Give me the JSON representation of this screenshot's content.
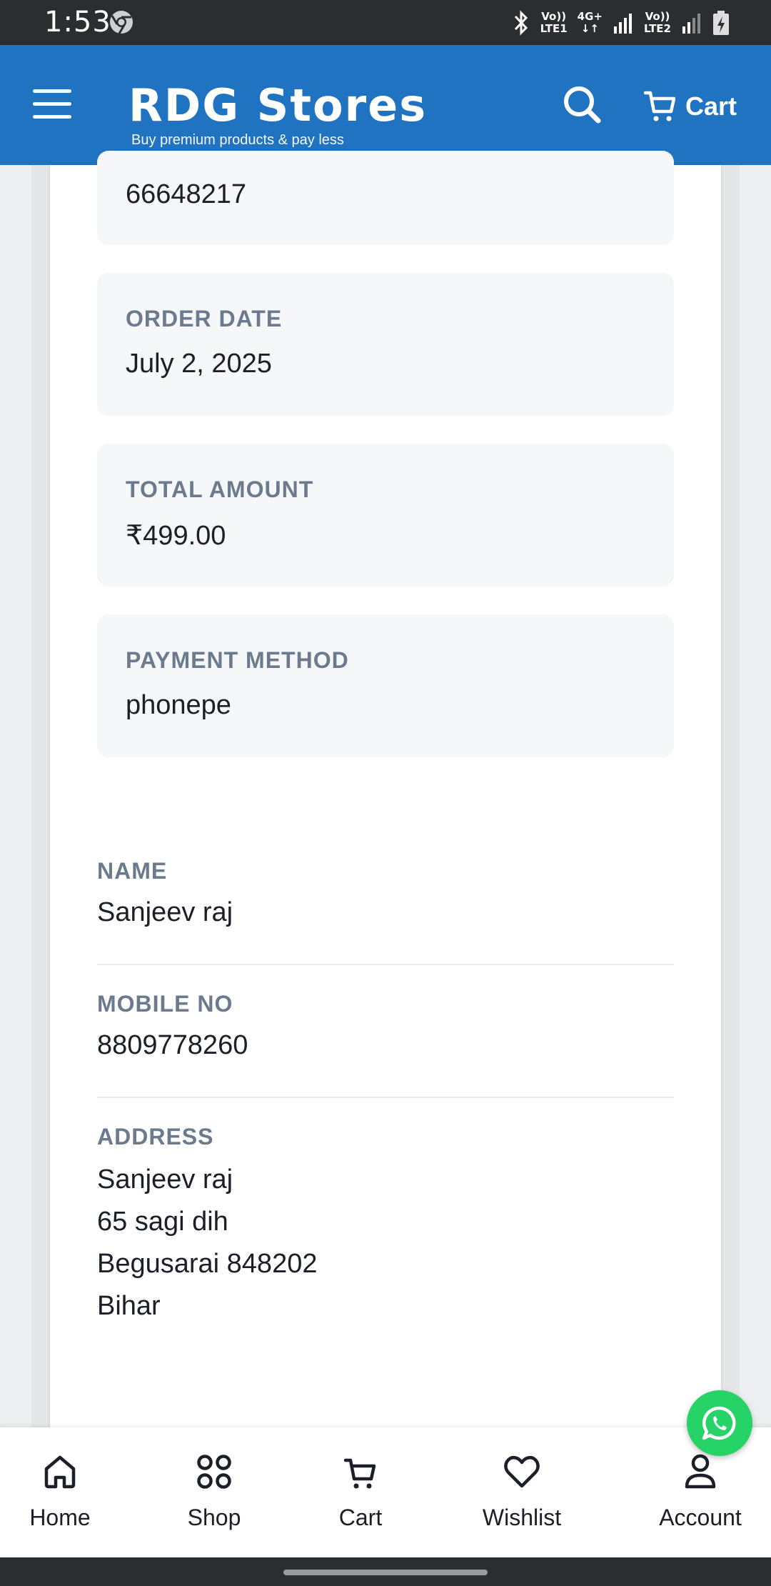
{
  "status_bar": {
    "time": "1:53",
    "network1_top": "Vo))",
    "network1_bottom": "LTE1",
    "data_type": "4G+",
    "network2_top": "Vo))",
    "network2_bottom": "LTE2"
  },
  "header": {
    "brand_title": "RDG Stores",
    "brand_tagline": "Buy premium products & pay less",
    "cart_label": "Cart",
    "background_color": "#1f73c1"
  },
  "order_details": {
    "order_number_value": "66648217",
    "order_date_label": "ORDER DATE",
    "order_date_value": "July 2, 2025",
    "total_amount_label": "TOTAL AMOUNT",
    "total_amount_value": "₹499.00",
    "payment_method_label": "PAYMENT METHOD",
    "payment_method_value": "phonepe"
  },
  "customer": {
    "name_label": "NAME",
    "name_value": "Sanjeev raj",
    "mobile_label": "MOBILE NO",
    "mobile_value": "8809778260",
    "address_label": "ADDRESS",
    "address_lines": [
      "Sanjeev raj",
      "65 sagi dih",
      "Begusarai 848202",
      "Bihar"
    ]
  },
  "bottom_nav": {
    "items": [
      {
        "label": "Home",
        "icon": "home-icon"
      },
      {
        "label": "Shop",
        "icon": "grid-dots-icon"
      },
      {
        "label": "Cart",
        "icon": "cart-icon"
      },
      {
        "label": "Wishlist",
        "icon": "heart-icon"
      },
      {
        "label": "Account",
        "icon": "user-icon"
      }
    ]
  },
  "colors": {
    "label_gray": "#6c7a8d",
    "whatsapp_green": "#25d366"
  }
}
